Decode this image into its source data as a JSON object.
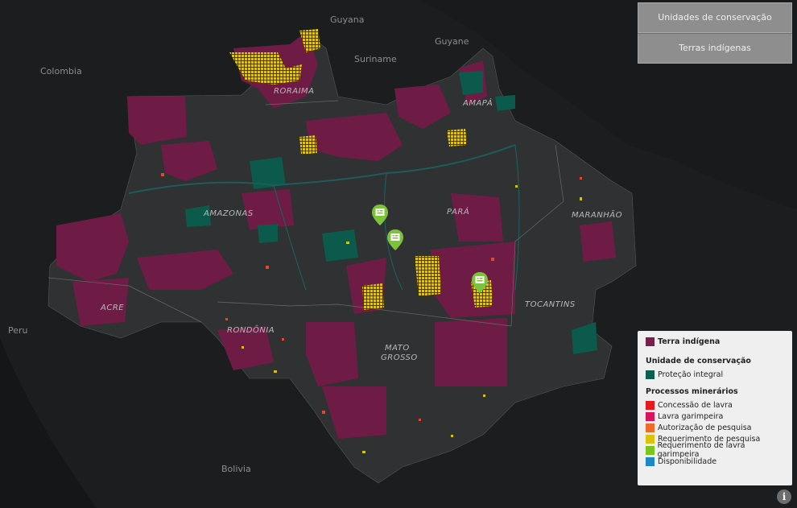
{
  "buttons": {
    "conservation_units": "Unidades de conservação",
    "indigenous_lands": "Terras indígenas"
  },
  "places": {
    "guyana": "Guyana",
    "suriname": "Suriname",
    "guyane": "Guyane",
    "colombia": "Colombia",
    "peru": "Peru",
    "bolivia": "Bolivia",
    "roraima": "RORAIMA",
    "amapa": "AMAPÁ",
    "amazonas": "AMAZONAS",
    "para": "PARÁ",
    "maranhao": "MARANHÃO",
    "acre": "ACRE",
    "rondonia": "RONDÔNIA",
    "tocantins": "TOCANTINS",
    "mato": "MATO",
    "grosso": "GROSSO"
  },
  "legend": {
    "indigenous_title": "Terra indígena",
    "conservation_title": "Unidade de conservação",
    "conservation_item": "Proteção integral",
    "mining_title": "Processos minerários",
    "mining_items": [
      "Concessão de lavra",
      "Lavra garimpeira",
      "Autorização de pesquisa",
      "Requerimento de pesquisa",
      "Requerimento de lavra garimpeira",
      "Disponibilidade"
    ]
  },
  "colors": {
    "indigenous": "#7a1e4c",
    "conservation": "#0c5e4e",
    "concessao": "#e8181e",
    "lavra_garimpeira": "#d8145c",
    "autorizacao": "#f06a2a",
    "requerimento_pesquisa": "#dcc20e",
    "requerimento_lavra": "#7cc41e",
    "disponibilidade": "#1f86c8",
    "pin": "#7cc23a"
  },
  "icons": {
    "info": "info-icon",
    "pin": "document-marker-icon"
  },
  "info_label": "i"
}
